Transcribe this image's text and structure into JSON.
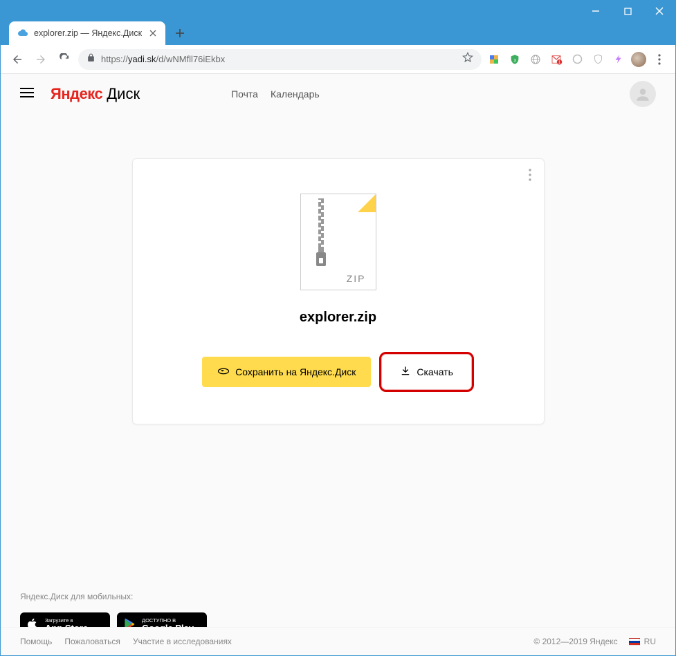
{
  "window": {
    "tab_title": "explorer.zip — Яндекс.Диск"
  },
  "toolbar": {
    "url_scheme": "https://",
    "url_host": "yadi.sk",
    "url_path": "/d/wNMfll76iEkbx"
  },
  "header": {
    "logo_ya": "Яндекс",
    "logo_disk": "Диск",
    "nav": {
      "mail": "Почта",
      "calendar": "Календарь"
    }
  },
  "card": {
    "file_ext_label": "ZIP",
    "filename": "explorer.zip",
    "save_label": "Сохранить на Яндекс.Диск",
    "download_label": "Скачать"
  },
  "footer": {
    "mobile_label": "Яндекс.Диск для мобильных:",
    "appstore_top": "Загрузите в",
    "appstore_bottom": "App Store",
    "gplay_top": "ДОСТУПНО В",
    "gplay_bottom": "Google Play",
    "links": {
      "help": "Помощь",
      "report": "Пожаловаться",
      "research": "Участие в исследованиях"
    },
    "copyright": "© 2012—2019 Яндекс",
    "lang": "RU"
  }
}
